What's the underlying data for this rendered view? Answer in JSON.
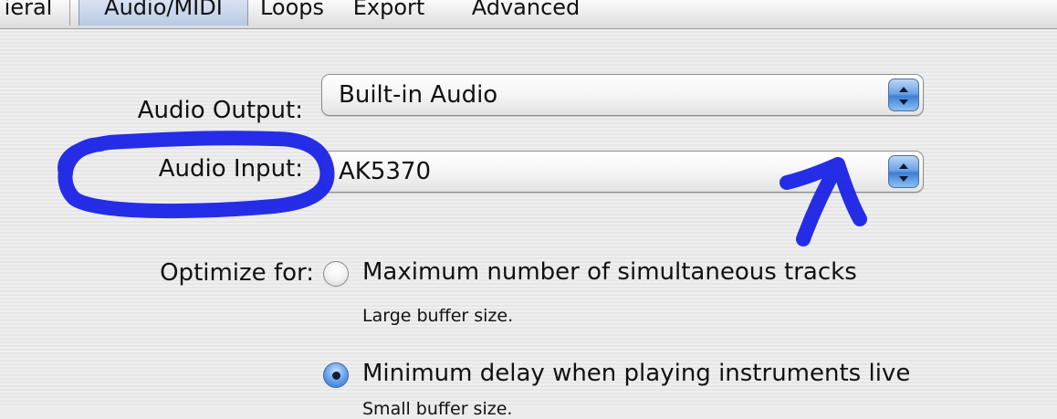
{
  "tabs": [
    {
      "label": "ieral",
      "selected": false
    },
    {
      "label": "Audio/MIDI",
      "selected": true
    },
    {
      "label": "Loops",
      "selected": false
    },
    {
      "label": "Export",
      "selected": false
    },
    {
      "label": "Advanced",
      "selected": false
    }
  ],
  "audio_output": {
    "label": "Audio Output:",
    "value": "Built-in Audio"
  },
  "audio_input": {
    "label": "Audio Input:",
    "value": "AK5370"
  },
  "optimize": {
    "label": "Optimize for:",
    "options": [
      {
        "label": "Maximum number of simultaneous tracks",
        "sub": "Large buffer size.",
        "checked": false
      },
      {
        "label": "Minimum delay when playing instruments live",
        "sub": "Small buffer size.",
        "checked": true
      }
    ]
  },
  "colors": {
    "annotation": "#1a22e6",
    "stepper_blue": "#3f7ed7",
    "window_bg": "#ececec"
  },
  "icons": {
    "popup_arrows": "up-down-chevron-icon",
    "annotation_circle": "hand-drawn-circle-annotation",
    "annotation_arrow": "hand-drawn-arrow-annotation"
  }
}
